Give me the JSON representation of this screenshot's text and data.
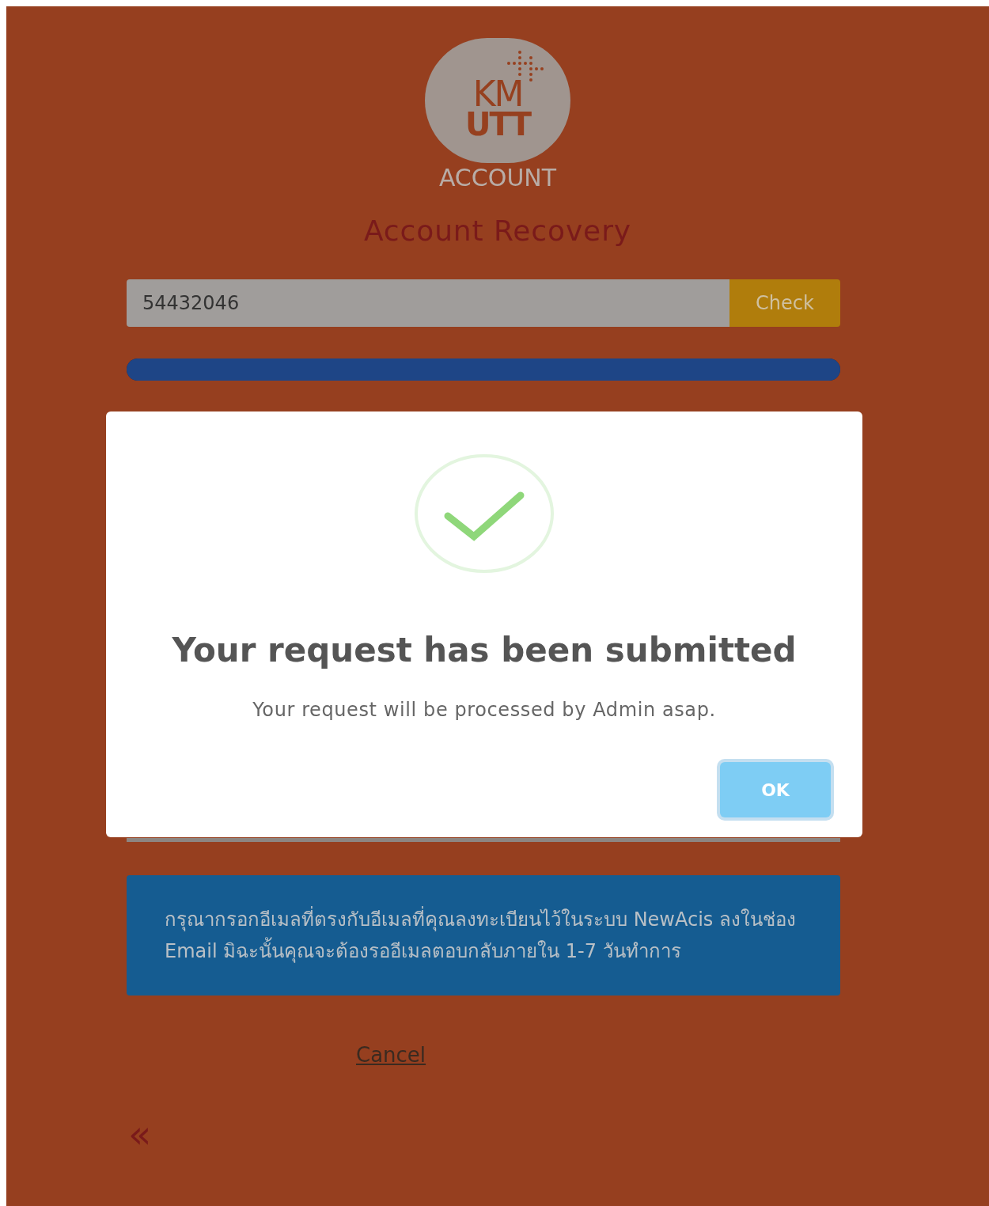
{
  "logo": {
    "lines": [
      "KM",
      "UTT"
    ],
    "caption": "ACCOUNT"
  },
  "title": "Account Recovery",
  "id_field": {
    "value": "54432046"
  },
  "check_button": "Check",
  "progress": {
    "level": 1
  },
  "notice": "กรุณากรอกอีเมลที่ตรงกับอีเมลที่คุณลงทะเบียนไว้ในระบบ NewAcis ลงในช่อง Email มิฉะนั้นคุณจะต้องรออีเมลตอบกลับภายใน 1-7 วันทำการ",
  "cancel_link": "Cancel",
  "back_link": "«",
  "dialog": {
    "title": "Your request has been submitted",
    "message": "Your request will be processed by Admin asap.",
    "button": "OK"
  }
}
